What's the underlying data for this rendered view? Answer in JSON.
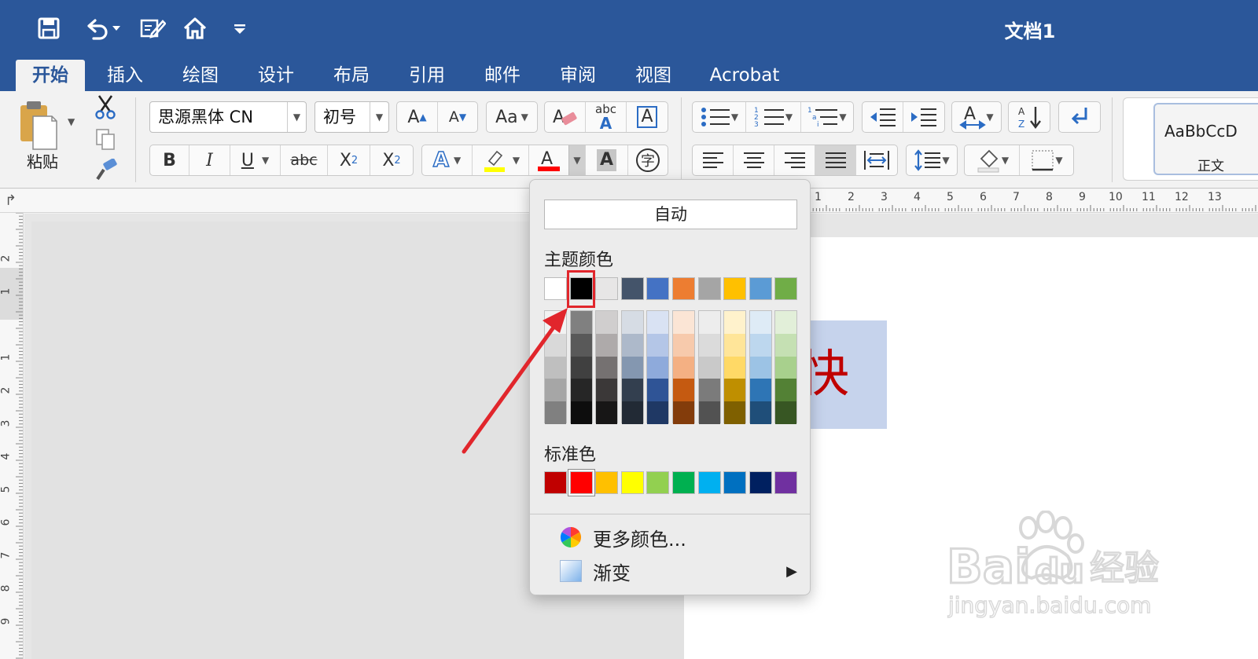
{
  "window": {
    "title": "文档1"
  },
  "tabs": [
    {
      "label": "开始",
      "active": true
    },
    {
      "label": "插入"
    },
    {
      "label": "绘图"
    },
    {
      "label": "设计"
    },
    {
      "label": "布局"
    },
    {
      "label": "引用"
    },
    {
      "label": "邮件"
    },
    {
      "label": "审阅"
    },
    {
      "label": "视图"
    },
    {
      "label": "Acrobat"
    }
  ],
  "ribbon": {
    "paste_label": "粘贴",
    "font_name": "思源黑体 CN",
    "font_size": "初号",
    "bold": "B",
    "italic": "I",
    "underline": "U",
    "strike": "abc",
    "abc_label": "abc",
    "style_preview": "AaBbCcD",
    "style_name": "正文"
  },
  "document": {
    "selected_text": "快乐",
    "text_color": "#c00000",
    "highlight": "#c6d3ec"
  },
  "ruler": {
    "h_ticks": [
      "1",
      "2",
      "3",
      "4",
      "5",
      "6",
      "7",
      "8",
      "9",
      "10",
      "11",
      "12",
      "13"
    ],
    "v_ticks": [
      "2",
      "1",
      "1",
      "2",
      "3",
      "4",
      "5",
      "6",
      "7",
      "8",
      "9"
    ]
  },
  "color_menu": {
    "auto_label": "自动",
    "theme_title": "主题颜色",
    "theme_colors": [
      "#ffffff",
      "#000000",
      "#e7e6e6",
      "#44546a",
      "#4472c4",
      "#ed7d31",
      "#a5a5a5",
      "#ffc000",
      "#5b9bd5",
      "#70ad47"
    ],
    "shades": [
      [
        "#f2f2f2",
        "#d9d9d9",
        "#bfbfbf",
        "#a6a6a6",
        "#808080"
      ],
      [
        "#808080",
        "#595959",
        "#404040",
        "#262626",
        "#0d0d0d"
      ],
      [
        "#d0cece",
        "#aeaaaa",
        "#757171",
        "#3b3838",
        "#171616"
      ],
      [
        "#d6dce4",
        "#adb9ca",
        "#8497b0",
        "#333f4f",
        "#222a35"
      ],
      [
        "#d9e2f3",
        "#b4c6e7",
        "#8eaadb",
        "#2f5496",
        "#1f3864"
      ],
      [
        "#fbe5d5",
        "#f7caac",
        "#f4b083",
        "#c55a11",
        "#833c0b"
      ],
      [
        "#ededed",
        "#dbdbdb",
        "#c9c9c9",
        "#7b7b7b",
        "#525252"
      ],
      [
        "#fff2cc",
        "#ffe599",
        "#ffd966",
        "#bf8f00",
        "#7f6000"
      ],
      [
        "#deebf6",
        "#bdd7ee",
        "#9cc3e5",
        "#2e75b5",
        "#1f4e79"
      ],
      [
        "#e2efd9",
        "#c5e0b3",
        "#a8d08d",
        "#538135",
        "#375623"
      ]
    ],
    "standard_title": "标准色",
    "standard_colors": [
      "#c00000",
      "#ff0000",
      "#ffc000",
      "#ffff00",
      "#92d050",
      "#00b050",
      "#00b0f0",
      "#0070c0",
      "#002060",
      "#7030a0"
    ],
    "more_colors": "更多颜色...",
    "gradient": "渐变"
  },
  "watermark": {
    "text": "Bai 经验",
    "sub": "jingyan.baidu.com"
  },
  "annotation": {
    "color": "#e1262c"
  }
}
